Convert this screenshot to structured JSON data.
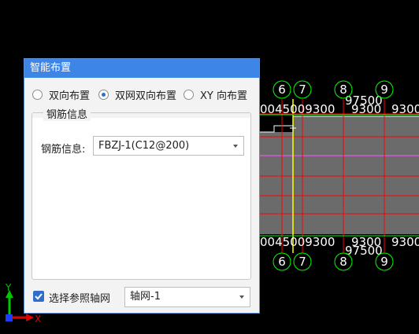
{
  "dialog": {
    "title": "智能布置",
    "radios": [
      {
        "label": "双向布置",
        "selected": false
      },
      {
        "label": "双网双向布置",
        "selected": true
      },
      {
        "label": "XY 向布置",
        "selected": false
      }
    ],
    "group": {
      "legend": "钢筋信息",
      "field_label": "钢筋信息:",
      "field_value": "FBZJ-1(C12@200)"
    },
    "ref_grid": {
      "checked": true,
      "label": "选择参照轴网",
      "value": "轴网-1"
    }
  },
  "cad": {
    "axis_top": [
      "6",
      "7",
      "8",
      "9"
    ],
    "axis_bottom": [
      "6",
      "7",
      "8",
      "9"
    ],
    "dims_top": [
      "0045009300",
      "9300",
      "9300",
      "97500"
    ],
    "dims_bottom": [
      "0045009300",
      "9300",
      "9300",
      "97500"
    ],
    "ucs": {
      "y": "Y",
      "x": "X"
    },
    "colors": {
      "slab": "#6b6b6b",
      "grid": "#ff0000",
      "axis_yellow": "#ffff00",
      "line_magenta": "#ff55ff",
      "circle": "#00ff00",
      "dim_green": "#00ff00"
    }
  }
}
